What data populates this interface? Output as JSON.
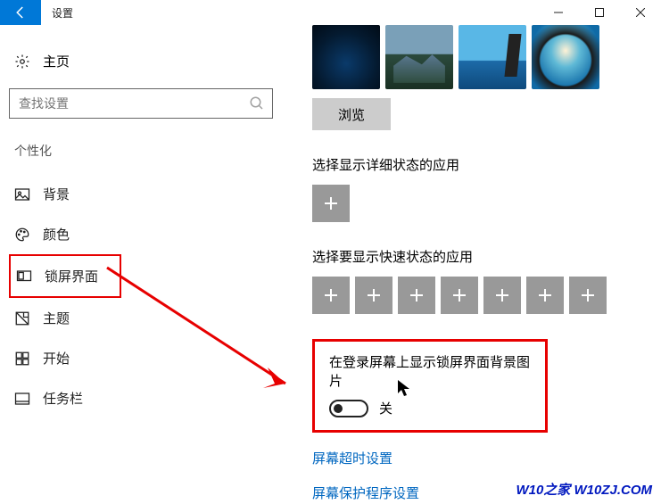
{
  "titlebar": {
    "title": "设置"
  },
  "left": {
    "home": "主页",
    "search_placeholder": "查找设置",
    "category": "个性化",
    "items": [
      {
        "label": "背景"
      },
      {
        "label": "颜色"
      },
      {
        "label": "锁屏界面"
      },
      {
        "label": "主题"
      },
      {
        "label": "开始"
      },
      {
        "label": "任务栏"
      }
    ]
  },
  "right": {
    "browse": "浏览",
    "detailed_label": "选择显示详细状态的应用",
    "quick_label": "选择要显示快速状态的应用",
    "toggle_label": "在登录屏幕上显示锁屏界面背景图片",
    "toggle_state": "关",
    "link_timeout": "屏幕超时设置",
    "link_saver": "屏幕保护程序设置"
  },
  "watermark": "W10之家 W10ZJ.COM"
}
